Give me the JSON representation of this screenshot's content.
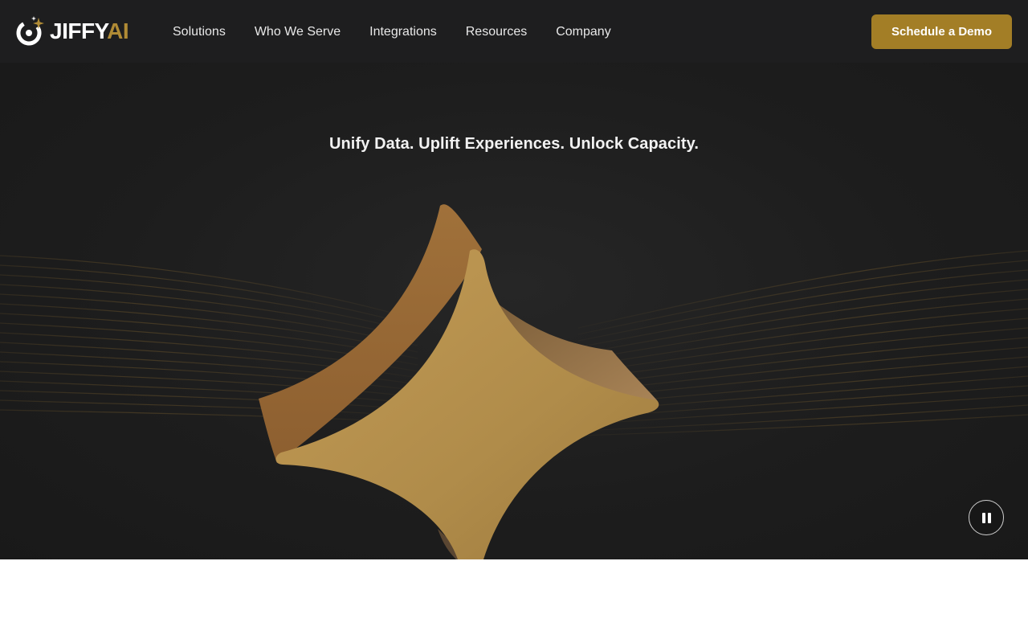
{
  "header": {
    "logo": {
      "word": "JIFFY",
      "accent": "AI",
      "icon": "jiffy-spark-logo-icon"
    },
    "nav": [
      {
        "label": "Solutions"
      },
      {
        "label": "Who We Serve"
      },
      {
        "label": "Integrations"
      },
      {
        "label": "Resources"
      },
      {
        "label": "Company"
      }
    ],
    "cta_label": "Schedule a Demo"
  },
  "hero": {
    "tagline": "Unify Data. Uplift Experiences. Unlock Capacity.",
    "visual": "gold-four-point-star",
    "pause_icon": "pause-icon"
  },
  "colors": {
    "header_bg": "#1e1e1f",
    "hero_bg": "#1d1d1d",
    "accent_gold": "#a37e26",
    "star_face": "#b48f4d",
    "star_side": "#9a6a35"
  }
}
